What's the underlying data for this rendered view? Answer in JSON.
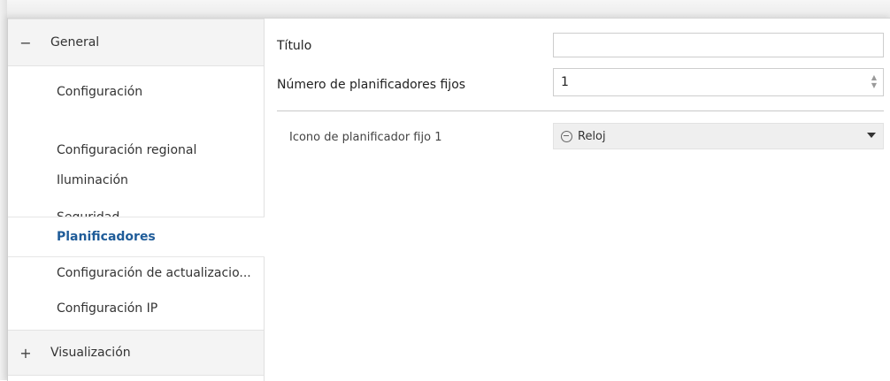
{
  "sidebar": {
    "groups": [
      {
        "sign": "−",
        "label": "General"
      },
      {
        "sign": "+",
        "label": "Visualización"
      }
    ],
    "items": [
      {
        "label": "Configuración"
      },
      {
        "label": "Configuración regional"
      },
      {
        "label": "Iluminación"
      },
      {
        "label": "Seguridad"
      },
      {
        "label": "Planificadores"
      },
      {
        "label": "Configuración de actualizacio..."
      },
      {
        "label": "Configuración IP"
      }
    ]
  },
  "content": {
    "title_label": "Título",
    "title_value": "",
    "count_label": "Número de planificadores fijos",
    "count_value": "1",
    "icon_label": "Icono de planificador fijo 1",
    "icon_value": "Reloj",
    "icon_name": "clock-icon"
  },
  "colors": {
    "active_nav": "#1f5c99",
    "header_bg": "#f4f4f4",
    "select_bg": "#efefef"
  }
}
